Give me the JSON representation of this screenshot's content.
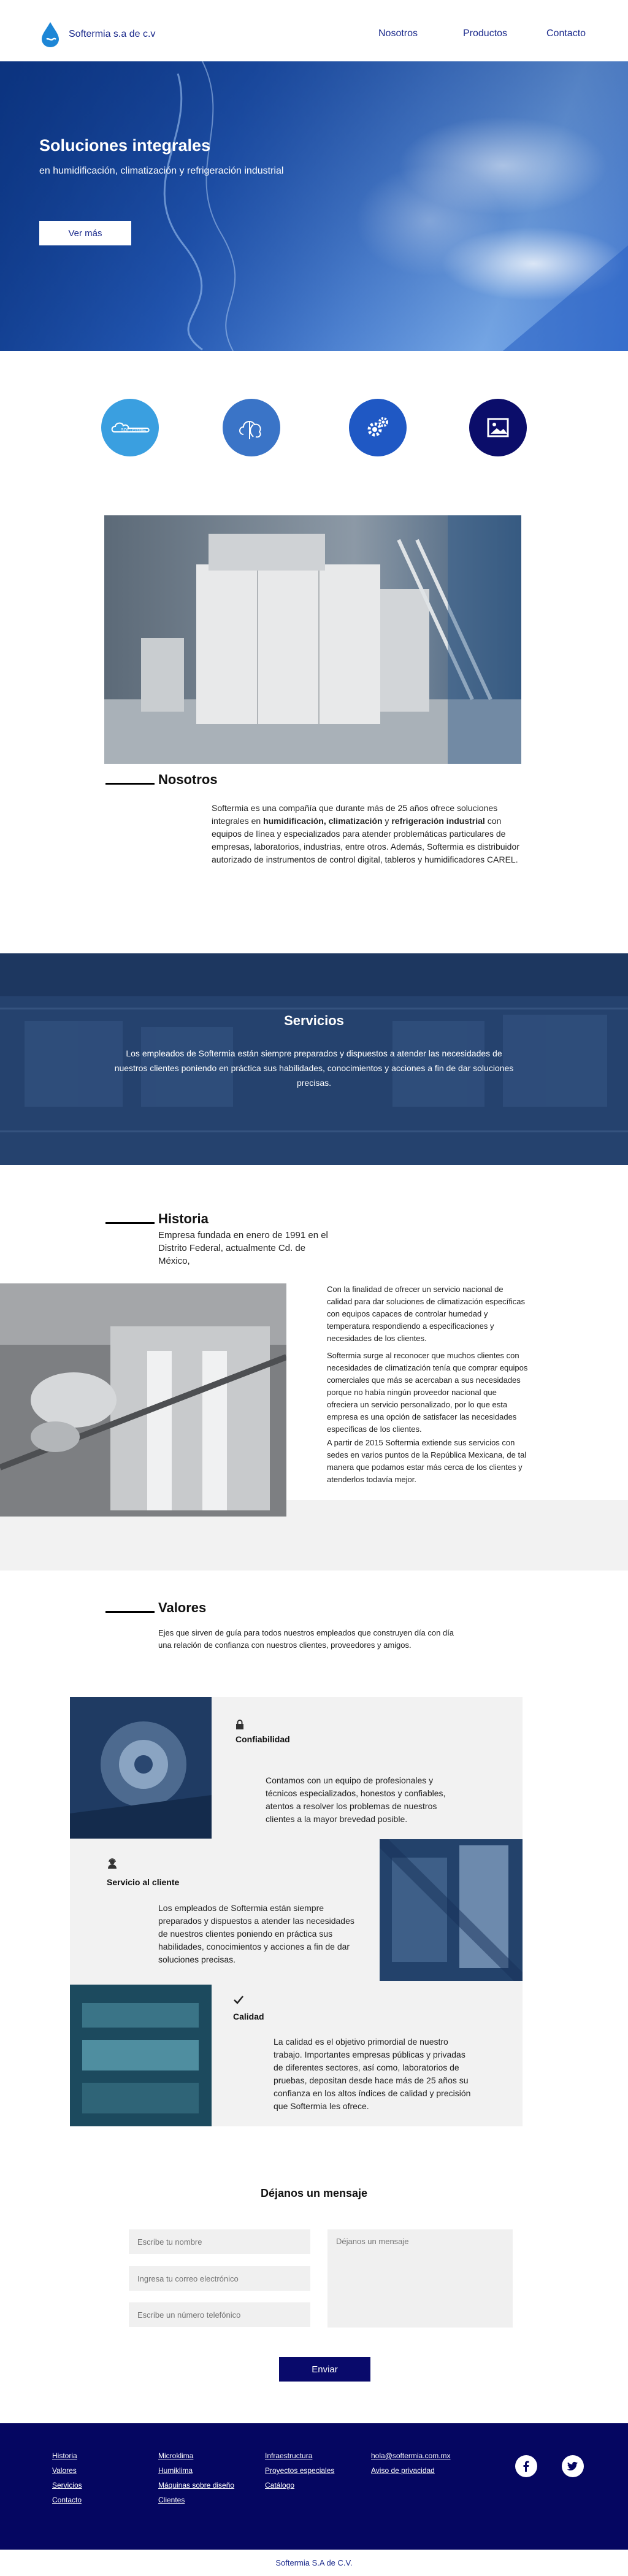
{
  "header": {
    "brand": "Softermia s.a de c.v",
    "nav": [
      "Nosotros",
      "Productos",
      "Contacto"
    ]
  },
  "hero": {
    "title": "Soluciones integrales",
    "subtitle": "en humidificación, climatización y refrigeración industrial",
    "button": "Ver más"
  },
  "feature_icons": [
    {
      "icon": "cloud-logo-icon",
      "color": "#3a9fe0"
    },
    {
      "icon": "cloud-flow-icon",
      "color": "#3a74c7"
    },
    {
      "icon": "gears-icon",
      "color": "#1f58c4"
    },
    {
      "icon": "image-icon",
      "color": "#0b0d6a"
    }
  ],
  "nosotros": {
    "title": "Nosotros",
    "text_1": "Softermia es una compañía que durante más de 25 años ofrece soluciones integrales en ",
    "bold_1": "humidificación, climatización",
    "text_2": " y ",
    "bold_2": "refrigeración industrial",
    "text_3": " con equipos de línea y especializados para atender problemáticas particulares de empresas, laboratorios, industrias, entre otros.   Además, Softermia es distribuidor autorizado de instrumentos de control digital, tableros y humidificadores CAREL."
  },
  "servicios": {
    "title": "Servicios",
    "text": "Los empleados de Softermia están siempre preparados y dispuestos a atender las necesidades de nuestros clientes poniendo en práctica sus habilidades, conocimientos y acciones a fin de dar soluciones precisas."
  },
  "historia": {
    "title": "Historia",
    "intro": "Empresa fundada en enero de 1991 en el Distrito Federal, actualmente Cd. de México,",
    "p1": "Con la finalidad de ofrecer un servicio nacional de calidad para dar soluciones de climatización específicas con equipos capaces de controlar humedad y temperatura respondiendo a especificaciones y necesidades de los clientes.",
    "p2": "Softermia surge al reconocer que muchos clientes con necesidades de climatización tenía que comprar equipos comerciales que más se acercaban a sus necesidades porque no había ningún proveedor nacional que ofreciera un servicio personalizado, por lo que esta empresa es una opción de satisfacer las necesidades específicas de los clientes.",
    "p3": "A partir de 2015 Softermia extiende sus servicios con sedes en varios puntos de la República Mexicana, de tal manera que podamos estar más cerca de los clientes y atenderlos todavía mejor."
  },
  "valores": {
    "title": "Valores",
    "intro": "Ejes que sirven de guía para todos nuestros empleados que construyen día con día una relación de confianza con nuestros clientes, proveedores y amigos.",
    "items": [
      {
        "title": "Confiabilidad",
        "icon": "lock-icon",
        "text": "Contamos con un equipo de profesionales y técnicos especializados, honestos y confiables, atentos a resolver los problemas de nuestros clientes a la mayor brevedad posible."
      },
      {
        "title": "Servicio al cliente",
        "icon": "support-icon",
        "text": "Los empleados de Softermia están siempre preparados y dispuestos a atender las necesidades de nuestros clientes poniendo en práctica sus habilidades, conocimientos y acciones a fin de dar soluciones precisas."
      },
      {
        "title": "Calidad",
        "icon": "check-icon",
        "text": "La calidad es el objetivo primordial de nuestro trabajo. Importantes empresas públicas y privadas de diferentes sectores, así como, laboratorios de pruebas, depositan desde hace más de 25 años su confianza en los altos índices de calidad y precisión que Softermia les ofrece."
      }
    ]
  },
  "contact": {
    "title": "Déjanos un mensaje",
    "name_placeholder": "Escribe tu nombre",
    "email_placeholder": "Ingresa tu correo electrónico",
    "phone_placeholder": "Escribe un número telefónico",
    "message_placeholder": "Déjanos un mensaje",
    "send": "Enviar"
  },
  "footer": {
    "col1": [
      "Historia",
      "Valores",
      "Servicios",
      "Contacto"
    ],
    "col2": [
      "Microklima",
      "Humiklima",
      "Máquinas sobre diseño",
      "Clientes"
    ],
    "col3": [
      "Infraestructura",
      "Proyectos especiales",
      "Catálogo"
    ],
    "col4": [
      "hola@softermia.com.mx",
      "Aviso de privacidad"
    ],
    "social": [
      "facebook-icon",
      "twitter-icon"
    ],
    "copyright": "Softermia S.A de C.V."
  }
}
